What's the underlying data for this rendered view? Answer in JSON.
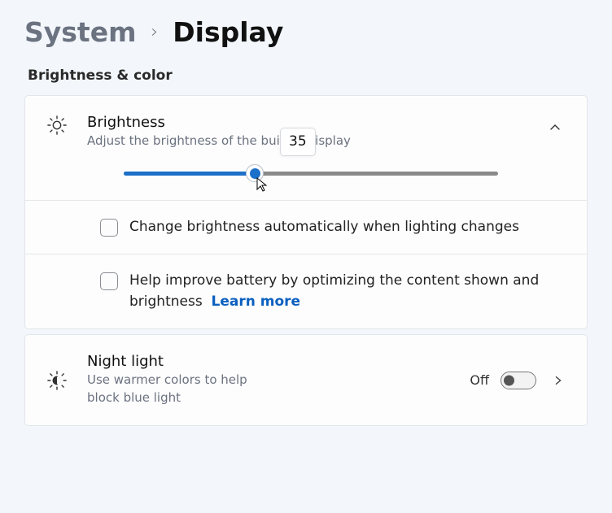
{
  "breadcrumb": {
    "parent": "System",
    "current": "Display"
  },
  "section": {
    "brightness_color": "Brightness & color"
  },
  "brightness": {
    "title": "Brightness",
    "desc": "Adjust the brightness of the built-in display",
    "value": 35,
    "value_label": "35",
    "auto_checkbox_label": "Change brightness automatically when lighting changes",
    "optimize_label": "Help improve battery by optimizing the content shown and brightness",
    "learn_more": "Learn more"
  },
  "nightlight": {
    "title": "Night light",
    "desc": "Use warmer colors to help block blue light",
    "state": "Off"
  }
}
